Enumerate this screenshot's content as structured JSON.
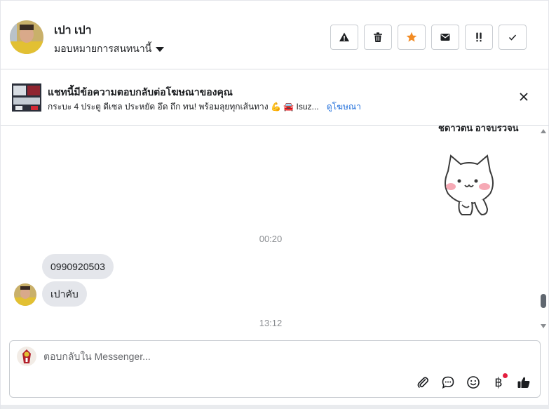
{
  "header": {
    "contact_name": "เปา เปา",
    "assign_label": "มอบหมายการสนทนานี้",
    "actions": [
      {
        "name": "report-button",
        "icon": "warning-icon"
      },
      {
        "name": "delete-button",
        "icon": "trash-icon"
      },
      {
        "name": "star-button",
        "icon": "star-icon"
      },
      {
        "name": "mark-unread-button",
        "icon": "envelope-icon"
      },
      {
        "name": "follow-up-button",
        "icon": "double-exclamation-icon"
      },
      {
        "name": "mark-done-button",
        "icon": "check-icon"
      }
    ],
    "star_color": "#f28b24"
  },
  "ad_banner": {
    "title": "แชทนี้มีข้อความตอบกลับต่อโฆษณาของคุณ",
    "subtitle": "กระบะ 4 ประตู ดีเซล ประหยัด อึด ถึก ทน! พร้อมลุยทุกเส้นทาง 💪 🚘 Isuz...",
    "link_label": "ดูโฆษณา",
    "link_color": "#216fdb"
  },
  "chat": {
    "clipped_top_text": "ชิดาวิตนั อาจิบริวิจน",
    "messages": [
      {
        "type": "timestamp",
        "text": "00:20"
      },
      {
        "type": "incoming",
        "text": "0990920503"
      },
      {
        "type": "incoming",
        "text": "เปาคับ"
      },
      {
        "type": "timestamp",
        "text": "13:12"
      }
    ]
  },
  "composer": {
    "placeholder": "ตอบกลับใน Messenger...",
    "tools": [
      "paperclip-icon",
      "chat-bubble-icon",
      "smiley-icon",
      "baht-icon",
      "thumbs-up-icon"
    ],
    "baht_symbol": "฿"
  }
}
